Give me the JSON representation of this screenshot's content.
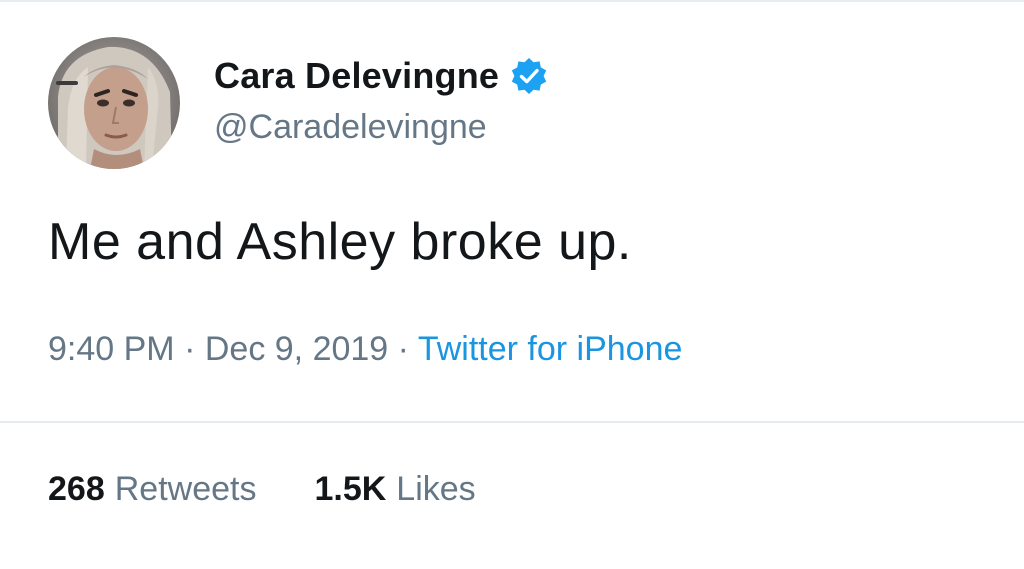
{
  "tweet": {
    "author": {
      "display_name": "Cara Delevingne",
      "handle": "@Caradelevingne",
      "verified_icon": "verified-badge-icon",
      "avatar": "profile-photo"
    },
    "text": "Me and Ashley broke up.",
    "time": "9:40 PM",
    "separator": "·",
    "date": "Dec 9, 2019",
    "source": "Twitter for iPhone",
    "stats": {
      "retweets_count": "268",
      "retweets_label": "Retweets",
      "likes_count": "1.5K",
      "likes_label": "Likes"
    }
  },
  "colors": {
    "primary_text": "#14171a",
    "secondary_text": "#657786",
    "link": "#1b95e0",
    "verified_badge": "#1da1f2",
    "divider": "#e6ecf0"
  }
}
